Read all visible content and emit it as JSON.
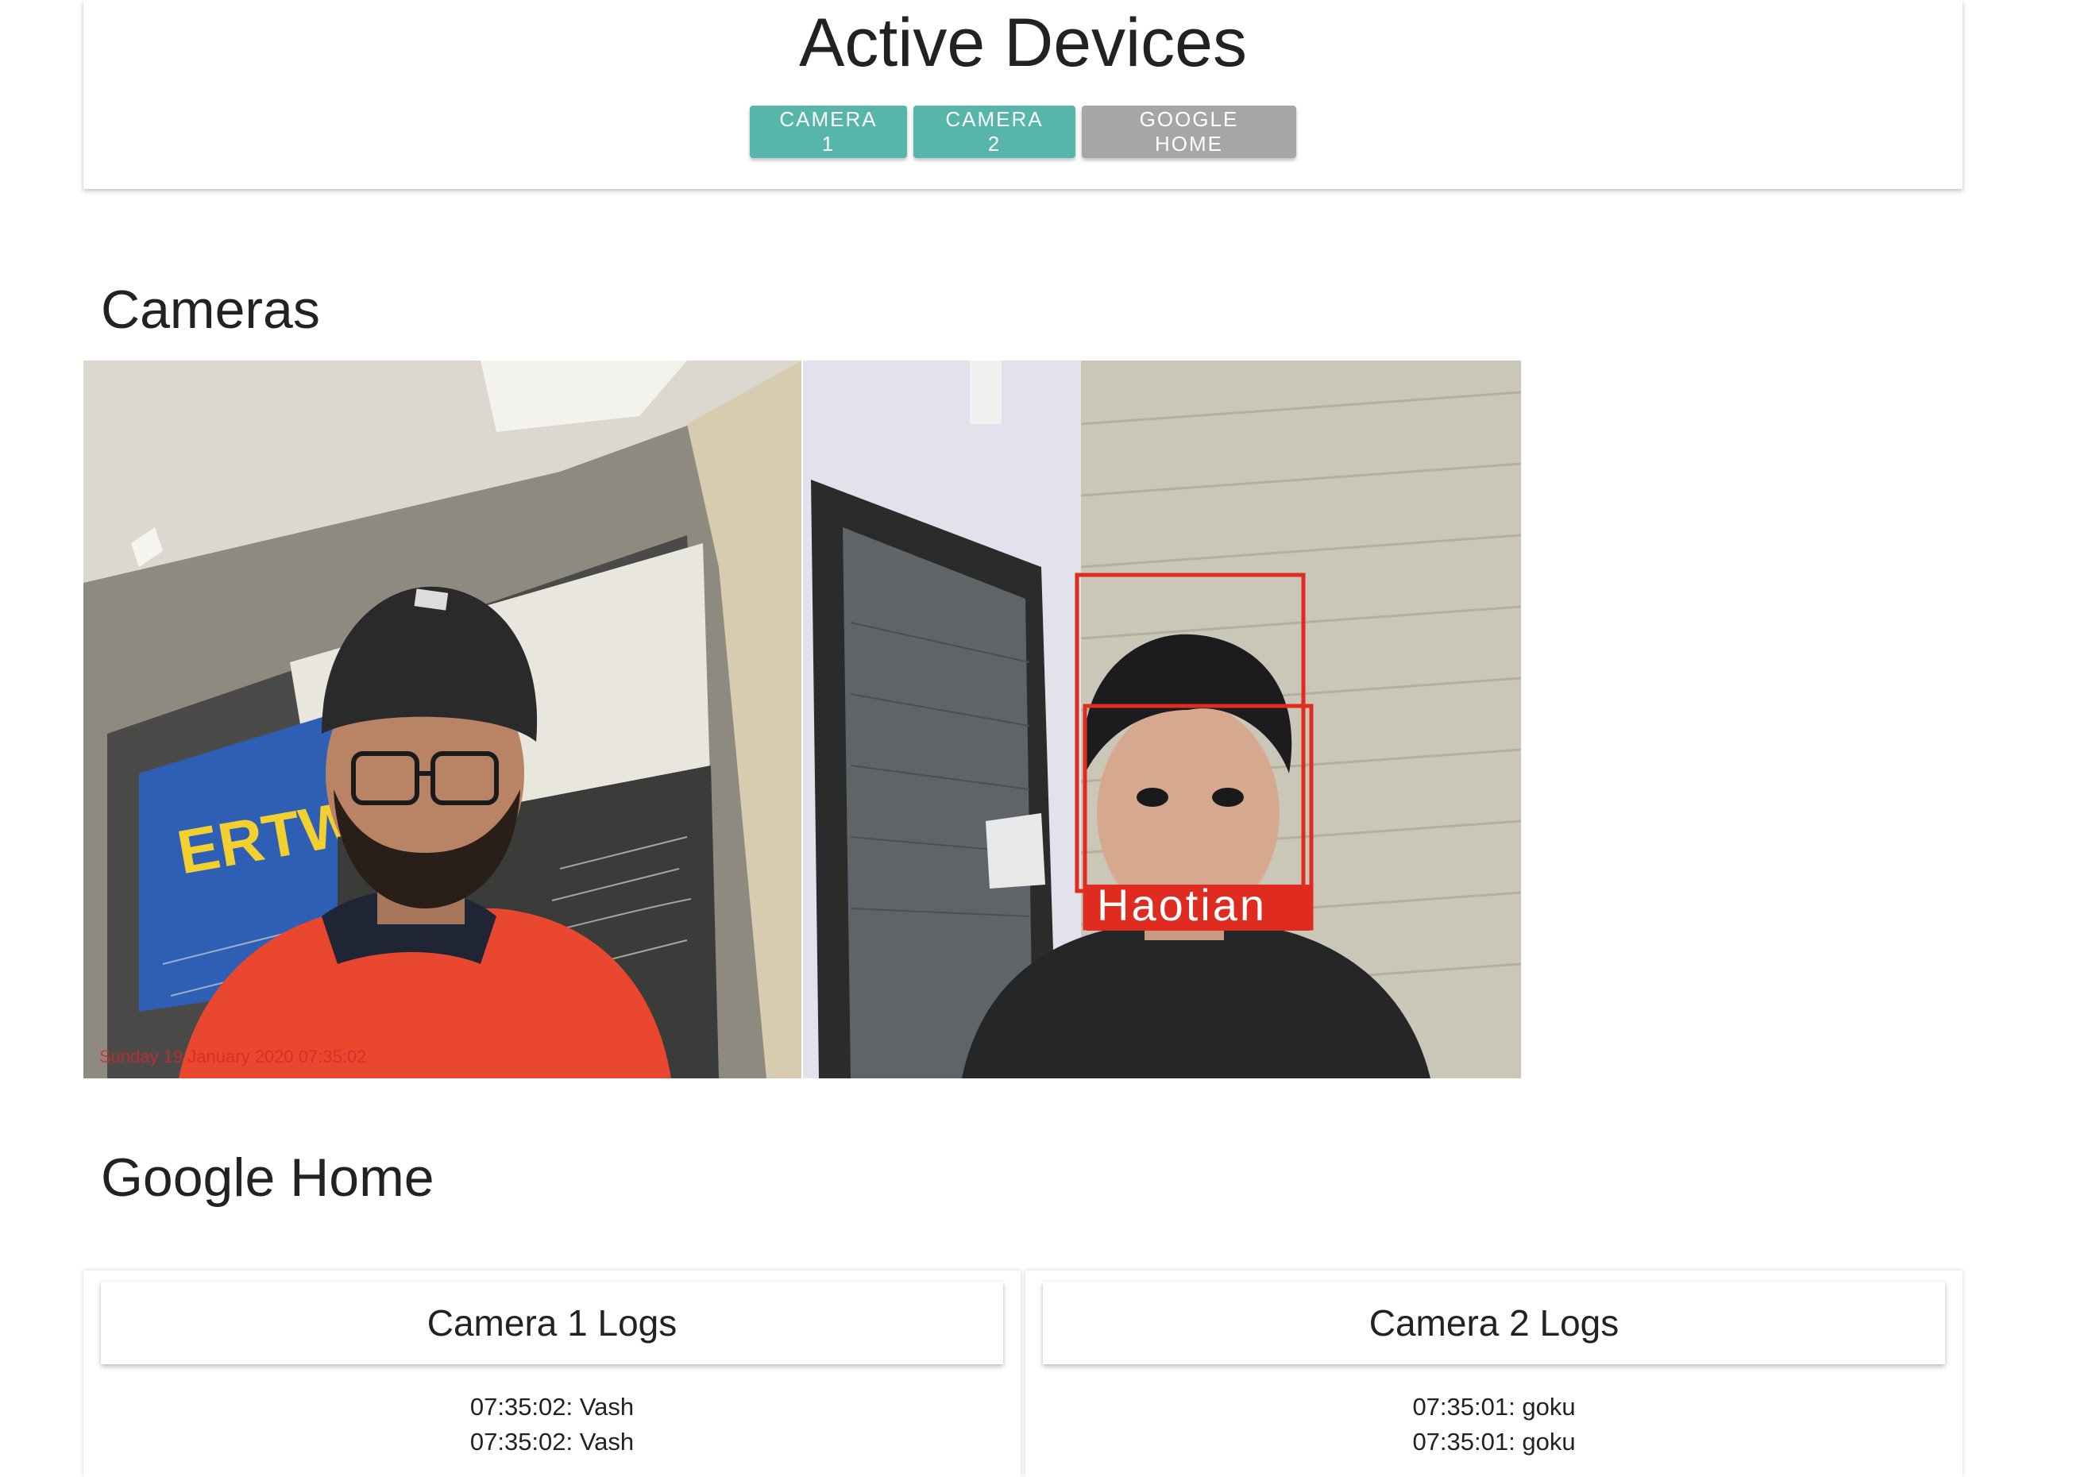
{
  "header": {
    "title": "Active Devices",
    "buttons": {
      "camera1": "CAMERA 1",
      "camera2": "CAMERA 2",
      "google_home": "GOOGLE HOME"
    }
  },
  "cameras": {
    "title": "Cameras",
    "feed1": {
      "timestamp": "Sunday 19 January 2020 07:35:02"
    },
    "feed2": {
      "detected_label": "Haotian"
    }
  },
  "google_home": {
    "title": "Google Home"
  },
  "logs": {
    "camera1": {
      "title": "Camera 1 Logs",
      "entries": [
        "07:35:02: Vash",
        "07:35:02: Vash"
      ]
    },
    "camera2": {
      "title": "Camera 2 Logs",
      "entries": [
        "07:35:01: goku",
        "07:35:01: goku"
      ]
    }
  },
  "colors": {
    "primary_button": "#55b6a9",
    "disabled_button": "#a6a6a6",
    "detection_box": "#e02b20"
  }
}
